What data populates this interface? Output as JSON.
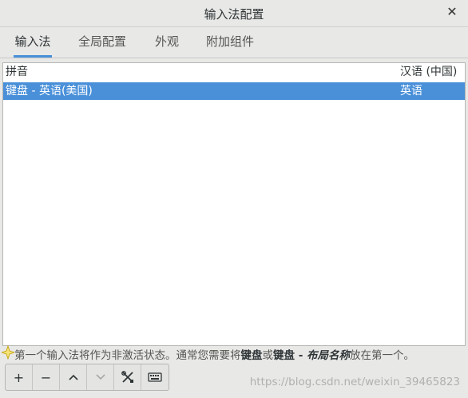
{
  "window": {
    "title": "输入法配置",
    "close_icon": "close-icon"
  },
  "tabs": [
    {
      "label": "输入法",
      "active": true
    },
    {
      "label": "全局配置",
      "active": false
    },
    {
      "label": "外观",
      "active": false
    },
    {
      "label": "附加组件",
      "active": false
    }
  ],
  "list": {
    "header": {
      "name": "拼音",
      "language": "汉语 (中国)"
    },
    "rows": [
      {
        "name": "键盘 - 英语(美国)",
        "language": "英语",
        "selected": true
      }
    ]
  },
  "hint": {
    "icon": "star-icon",
    "part1": "第一个输入法将作为非激活状态。通常您需要将",
    "bold1": "键盘",
    "part2": "或",
    "bold2": "键盘 - ",
    "italic": "布局名称",
    "part3": "放在第一个。"
  },
  "toolbar": {
    "buttons": [
      {
        "name": "add",
        "icon": "plus-icon",
        "glyph": "+"
      },
      {
        "name": "remove",
        "icon": "minus-icon",
        "glyph": "−"
      },
      {
        "name": "move-up",
        "icon": "chevron-up-icon",
        "glyph": "︿"
      },
      {
        "name": "move-down",
        "icon": "chevron-down-icon",
        "glyph": "﹀",
        "disabled": true
      },
      {
        "name": "configure",
        "icon": "tools-icon",
        "glyph": "✂"
      },
      {
        "name": "keyboard-layout",
        "icon": "keyboard-icon",
        "glyph": "⌨"
      }
    ]
  },
  "watermark": "https://blog.csdn.net/weixin_39465823",
  "colors": {
    "selection": "#4a90d9",
    "background": "#e8e8e7"
  }
}
